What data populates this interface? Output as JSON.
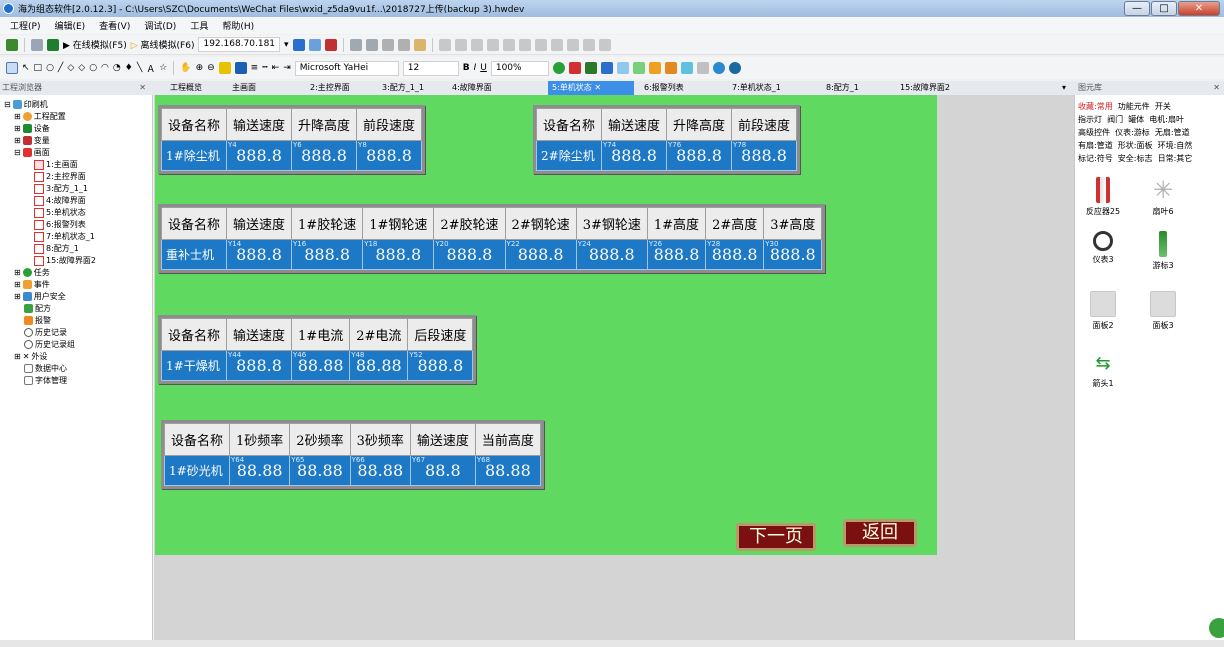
{
  "window": {
    "title": "海为组态软件[2.0.12.3] - C:\\Users\\SZC\\Documents\\WeChat Files\\wxid_z5da9vu1f...\\2018727上传(backup 3).hwdev",
    "min": "—",
    "max": "□",
    "close": "✕"
  },
  "menu": [
    "工程(P)",
    "编辑(E)",
    "查看(V)",
    "调试(D)",
    "工具",
    "帮助(H)"
  ],
  "toolbar": {
    "online_sim": "在线模拟(F5)",
    "offline_sim": "离线模拟(F6)",
    "ip": "192.168.70.181",
    "font": "Microsoft YaHei",
    "font_size": "12",
    "zoom": "100%"
  },
  "panels": {
    "project_browser": "工程浏览器",
    "library": "图元库"
  },
  "tabs": [
    "工程概览",
    "主画面",
    "2:主控界面",
    "3:配方_1_1",
    "4:故障界面",
    "5:单机状态",
    "6:报警列表",
    "7:单机状态_1",
    "8:配方_1",
    "15:故障界面2"
  ],
  "active_tab": "5:单机状态",
  "tree": {
    "root": "印刷机",
    "items": [
      "工程配置",
      "设备",
      "变量",
      "画面"
    ],
    "screens": [
      "1:主画面",
      "2:主控界面",
      "3:配方_1_1",
      "4:故障界面",
      "5:单机状态",
      "6:报警列表",
      "7:单机状态_1",
      "8:配方_1",
      "15:故障界面2"
    ],
    "others": [
      "任务",
      "事件",
      "用户安全",
      "配方",
      "报警",
      "历史记录",
      "历史记录组",
      "外设",
      "数据中心",
      "字体管理"
    ]
  },
  "tables": [
    {
      "headers": [
        "设备名称",
        "输送速度",
        "升降高度",
        "前段速度"
      ],
      "name": "1#除尘机",
      "tags": [
        "Y4",
        "Y6",
        "Y8"
      ],
      "values": [
        "888.8",
        "888.8",
        "888.8"
      ]
    },
    {
      "headers": [
        "设备名称",
        "输送速度",
        "升降高度",
        "前段速度"
      ],
      "name": "2#除尘机",
      "tags": [
        "Y74",
        "Y76",
        "Y78"
      ],
      "values": [
        "888.8",
        "888.8",
        "888.8"
      ]
    },
    {
      "headers": [
        "设备名称",
        "输送速度",
        "1#胶轮速",
        "1#钢轮速",
        "2#胶轮速",
        "2#钢轮速",
        "3#钢轮速",
        "1#高度",
        "2#高度",
        "3#高度"
      ],
      "name": "重补士机",
      "tags": [
        "Y14",
        "Y16",
        "Y18",
        "Y20",
        "Y22",
        "Y24",
        "Y26",
        "Y28",
        "Y30"
      ],
      "values": [
        "888.8",
        "888.8",
        "888.8",
        "888.8",
        "888.8",
        "888.8",
        "888.8",
        "888.8",
        "888.8"
      ]
    },
    {
      "headers": [
        "设备名称",
        "输送速度",
        "1#电流",
        "2#电流",
        "后段速度"
      ],
      "name": "1#干燥机",
      "tags": [
        "Y44",
        "Y46",
        "Y48",
        "Y52"
      ],
      "values": [
        "888.8",
        "88.88",
        "88.88",
        "888.8"
      ]
    },
    {
      "headers": [
        "设备名称",
        "1砂频率",
        "2砂频率",
        "3砂频率",
        "输送速度",
        "当前高度"
      ],
      "name": "1#砂光机",
      "tags": [
        "Y64",
        "Y65",
        "Y66",
        "Y67",
        "Y68"
      ],
      "values": [
        "88.88",
        "88.88",
        "88.88",
        "88.8",
        "88.88"
      ]
    }
  ],
  "buttons": {
    "next": "下一页",
    "back": "返回"
  },
  "library": {
    "categories": [
      [
        "收藏:常用",
        "功能元件",
        "开关"
      ],
      [
        "指示灯",
        "阀门",
        "罐体",
        "电机:扇叶"
      ],
      [
        "高级控件",
        "仪表:游标",
        "无扇:管道"
      ],
      [
        "有扇:管道",
        "形状:面板",
        "环境:自然"
      ],
      [
        "标记:符号",
        "安全:标志",
        "日常:其它"
      ]
    ],
    "items": [
      "反应器25",
      "扇叶6",
      "仪表3",
      "游标3",
      "面板2",
      "面板3",
      "箭头1"
    ]
  },
  "colors": {
    "screen_bg": "#5fd95f",
    "value_cell": "#1d78c6",
    "nav_button": "#7a1010",
    "active_tab": "#3c8ee6"
  }
}
